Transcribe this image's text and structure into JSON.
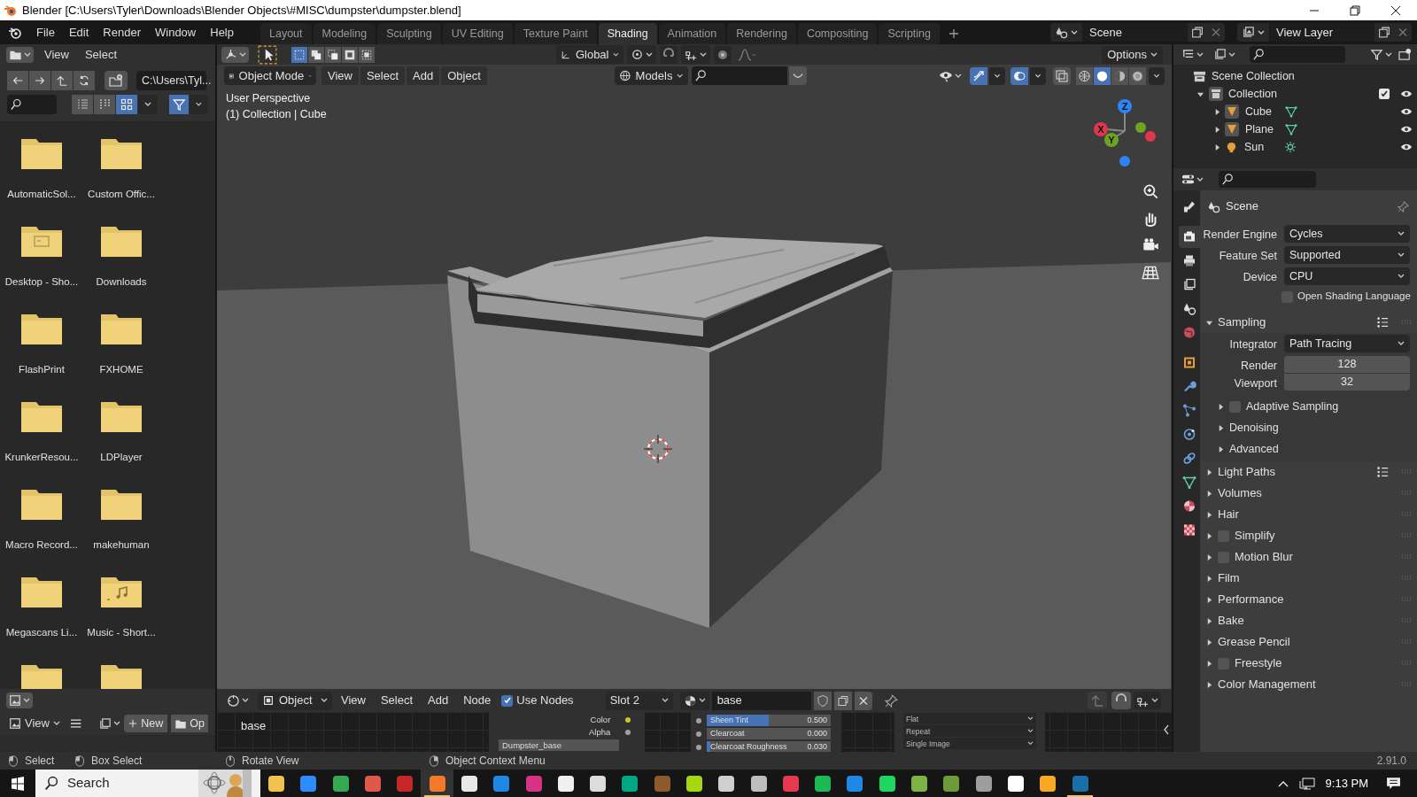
{
  "window": {
    "title": "Blender [C:\\Users\\Tyler\\Downloads\\Blender Objects\\#MISC\\dumpster\\dumpster.blend]"
  },
  "menu": [
    "File",
    "Edit",
    "Render",
    "Window",
    "Help"
  ],
  "workspaces": [
    {
      "label": "Layout",
      "selected": false
    },
    {
      "label": "Modeling",
      "selected": false
    },
    {
      "label": "Sculpting",
      "selected": false
    },
    {
      "label": "UV Editing",
      "selected": false
    },
    {
      "label": "Texture Paint",
      "selected": false
    },
    {
      "label": "Shading",
      "selected": true
    },
    {
      "label": "Animation",
      "selected": false
    },
    {
      "label": "Rendering",
      "selected": false
    },
    {
      "label": "Compositing",
      "selected": false
    },
    {
      "label": "Scripting",
      "selected": false
    }
  ],
  "scene": "Scene",
  "view_layer": "View Layer",
  "file_browser": {
    "menu": [
      "View",
      "Select"
    ],
    "path": "C:\\Users\\Tyl...",
    "display_modes": [
      {
        "selected": false
      },
      {
        "selected": false
      },
      {
        "selected": true
      }
    ],
    "filter_on": true,
    "items": [
      {
        "label": "AutomaticSol...",
        "kind": "folder"
      },
      {
        "label": "Custom Offic...",
        "kind": "folder"
      },
      {
        "label": "Desktop - Sho...",
        "kind": "desktop"
      },
      {
        "label": "Downloads",
        "kind": "folder"
      },
      {
        "label": "FlashPrint",
        "kind": "folder"
      },
      {
        "label": "FXHOME",
        "kind": "folder"
      },
      {
        "label": "KrunkerResou...",
        "kind": "folder"
      },
      {
        "label": "LDPlayer",
        "kind": "folder"
      },
      {
        "label": "Macro Record...",
        "kind": "folder"
      },
      {
        "label": "makehuman",
        "kind": "folder"
      },
      {
        "label": "Megascans Li...",
        "kind": "folder"
      },
      {
        "label": "Music - Short...",
        "kind": "music"
      },
      {
        "kind": "folder"
      },
      {
        "kind": "folder"
      }
    ]
  },
  "image_editor": {
    "menu": "View",
    "new": "New",
    "cut_label": "Op"
  },
  "viewport": {
    "orientation": "Global",
    "options": "Options",
    "mode": "Object Mode",
    "menu": [
      "View",
      "Select",
      "Add",
      "Object"
    ],
    "collection_filter": "Models",
    "select_modes": [
      {
        "selected": true
      },
      {
        "selected": false
      },
      {
        "selected": false
      },
      {
        "selected": false
      },
      {
        "selected": false
      }
    ],
    "gizmos_on": true,
    "overlays_on": true,
    "shading_modes": [
      {
        "selected": false
      },
      {
        "selected": true
      },
      {
        "selected": false
      },
      {
        "selected": false
      }
    ],
    "overlay_text": [
      "User Perspective",
      "(1) Collection | Cube"
    ],
    "axes": [
      "Z",
      "X",
      "Y"
    ]
  },
  "outliner": {
    "root": "Scene Collection",
    "collection": {
      "label": "Collection",
      "checked": true,
      "expanded": true,
      "children": [
        {
          "label": "Cube",
          "kind": "mesh"
        },
        {
          "label": "Plane",
          "kind": "mesh"
        },
        {
          "label": "Sun",
          "kind": "light"
        }
      ]
    }
  },
  "properties": {
    "tabs": [
      {
        "kind": "tool",
        "selected": false
      },
      {
        "kind": "render",
        "selected": true
      },
      {
        "kind": "output",
        "selected": false
      },
      {
        "kind": "view_layer",
        "selected": false
      },
      {
        "kind": "scene",
        "selected": false
      },
      {
        "kind": "world",
        "selected": false
      },
      {
        "kind": "object",
        "selected": false
      },
      {
        "kind": "modifiers",
        "selected": false
      },
      {
        "kind": "particles",
        "selected": false
      },
      {
        "kind": "physics",
        "selected": false
      },
      {
        "kind": "constraints",
        "selected": false
      },
      {
        "kind": "data",
        "selected": false
      },
      {
        "kind": "material",
        "selected": false
      },
      {
        "kind": "texture",
        "selected": false
      }
    ],
    "context": "Scene",
    "fields": [
      {
        "label": "Render Engine",
        "value": "Cycles"
      },
      {
        "label": "Feature Set",
        "value": "Supported"
      },
      {
        "label": "Device",
        "value": "CPU"
      }
    ],
    "osl": {
      "label": "Open Shading Language",
      "checked": false
    },
    "panels": [
      {
        "label": "Sampling",
        "expanded": true,
        "presets": true,
        "integrator": {
          "label": "Integrator",
          "value": "Path Tracing"
        },
        "samples": [
          {
            "label": "Render",
            "value": "128"
          },
          {
            "label": "Viewport",
            "value": "32"
          }
        ],
        "subpanels": [
          {
            "label": "Adaptive Sampling",
            "checked": false
          },
          {
            "label": "Denoising"
          },
          {
            "label": "Advanced"
          }
        ]
      },
      {
        "label": "Light Paths",
        "expanded": false,
        "presets": true
      },
      {
        "label": "Volumes",
        "expanded": false
      },
      {
        "label": "Hair",
        "expanded": false
      },
      {
        "label": "Simplify",
        "expanded": false,
        "checked": false
      },
      {
        "label": "Motion Blur",
        "expanded": false,
        "checked": false
      },
      {
        "label": "Film",
        "expanded": false
      },
      {
        "label": "Performance",
        "expanded": false
      },
      {
        "label": "Bake",
        "expanded": false
      },
      {
        "label": "Grease Pencil",
        "expanded": false
      },
      {
        "label": "Freestyle",
        "expanded": false,
        "checked": false
      },
      {
        "label": "Color Management",
        "expanded": false
      }
    ]
  },
  "node_editor": {
    "type": "Object",
    "menu": [
      "View",
      "Select",
      "Add",
      "Node"
    ],
    "use_nodes": {
      "label": "Use Nodes",
      "checked": true
    },
    "slot": "Slot 2",
    "material": "base",
    "frame_label": "base",
    "sockets": [
      "Color",
      "Alpha"
    ],
    "image_name": "Dumpster_base",
    "inputs": [
      {
        "label": "Sheen Tint",
        "value": "0.500",
        "level": 0.5
      },
      {
        "label": "Clearcoat",
        "value": "0.000",
        "level": 0
      },
      {
        "label": "Clearcoat Roughness",
        "value": "0.030",
        "level": 0.03
      }
    ],
    "image_options": [
      "Flat",
      "Repeat",
      "Single Image"
    ]
  },
  "status_bar": {
    "items": [
      {
        "kind": "left",
        "label": "Select"
      },
      {
        "kind": "drag",
        "label": "Box Select"
      },
      {
        "kind": "middle",
        "label": "Rotate View"
      },
      {
        "kind": "right",
        "label": "Object Context Menu"
      }
    ],
    "version": "2.91.0"
  },
  "taskbar": {
    "search": "Search",
    "time": "9:13 PM",
    "apps": [
      {
        "color": "#f2c14e",
        "active": false
      },
      {
        "color": "#2d8cff",
        "active": false
      },
      {
        "color": "#34a853",
        "active": false
      },
      {
        "color": "#e2574c",
        "active": false
      },
      {
        "color": "#c62828",
        "active": false
      },
      {
        "color": "#f5792a",
        "active": true
      },
      {
        "color": "#e8e8e8",
        "active": false
      },
      {
        "color": "#1e88e5",
        "active": false
      },
      {
        "color": "#d63384",
        "active": false
      },
      {
        "color": "#f0f0f0",
        "active": false
      },
      {
        "color": "#dcdcdc",
        "active": false
      },
      {
        "color": "#00a884",
        "active": false
      },
      {
        "color": "#8d5a2b",
        "active": false
      },
      {
        "color": "#a5d610",
        "active": false
      },
      {
        "color": "#cfcfcf",
        "active": false
      },
      {
        "color": "#bdbdbd",
        "active": false
      },
      {
        "color": "#e53950",
        "active": false
      },
      {
        "color": "#1db954",
        "active": false
      },
      {
        "color": "#1e88e5",
        "active": false
      },
      {
        "color": "#1ed760",
        "active": false
      },
      {
        "color": "#7cb342",
        "active": false
      },
      {
        "color": "#6d9b3a",
        "active": false
      },
      {
        "color": "#9e9e9e",
        "active": false
      },
      {
        "color": "#ffffff",
        "active": false
      },
      {
        "color": "#f9a825",
        "active": false
      },
      {
        "color": "#1b6fa8",
        "active": true
      }
    ]
  }
}
